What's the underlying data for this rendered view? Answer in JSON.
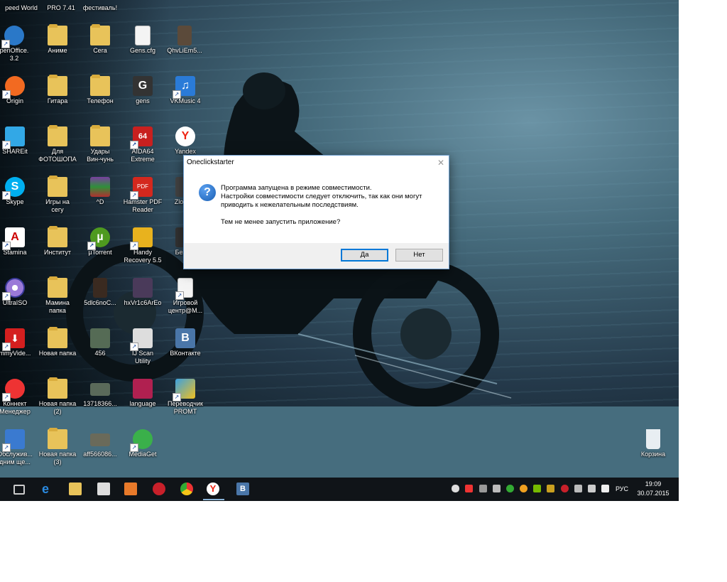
{
  "desktop": {
    "top_labels": [
      "peed World",
      "PRO 7.41",
      "фестиваль!"
    ],
    "icons": [
      {
        "label": "penOffice.\n3.2",
        "icon": "openoffice-icon"
      },
      {
        "label": "Аниме",
        "icon": "folder-icon"
      },
      {
        "label": "Сега",
        "icon": "folder-icon"
      },
      {
        "label": "Gens.cfg",
        "icon": "file-icon"
      },
      {
        "label": "QhvLiEm5...",
        "icon": "image-icon"
      },
      {
        "label": "Origin",
        "icon": "origin-icon"
      },
      {
        "label": "Гитара",
        "icon": "folder-icon"
      },
      {
        "label": "Телефон",
        "icon": "folder-icon"
      },
      {
        "label": "gens",
        "icon": "gens-icon"
      },
      {
        "label": "VKMusic 4",
        "icon": "vkmusic-icon"
      },
      {
        "label": "SHAREit",
        "icon": "shareit-icon"
      },
      {
        "label": "Для\nФОТОШОПА",
        "icon": "folder-icon"
      },
      {
        "label": "Удары\nВин-чунь",
        "icon": "folder-icon"
      },
      {
        "label": "AIDA64\nExtreme",
        "icon": "aida64-icon"
      },
      {
        "label": "Yandex",
        "icon": "yandex-icon"
      },
      {
        "label": "Skype",
        "icon": "skype-icon"
      },
      {
        "label": "Игры на\nсегу",
        "icon": "folder-icon"
      },
      {
        "label": "^D",
        "icon": "winrar-icon"
      },
      {
        "label": "Hamster PDF\nReader",
        "icon": "pdf-icon"
      },
      {
        "label": "ZloBF...",
        "icon": "app-icon"
      },
      {
        "label": "Stamina",
        "icon": "stamina-icon"
      },
      {
        "label": "Институт",
        "icon": "folder-icon"
      },
      {
        "label": "µTorrent",
        "icon": "utorrent-icon"
      },
      {
        "label": "Handy\nRecovery 5.5",
        "icon": "handy-recovery-icon"
      },
      {
        "label": "Безы...",
        "icon": "app-icon"
      },
      {
        "label": "UltraISO",
        "icon": "ultraiso-icon"
      },
      {
        "label": "Мамина\nпапка",
        "icon": "folder-icon"
      },
      {
        "label": "5dlc6noC...",
        "icon": "image-icon"
      },
      {
        "label": "hxVr1c6ArEo",
        "icon": "image-icon"
      },
      {
        "label": "Игровой\nцентр@M...",
        "icon": "game-center-icon"
      },
      {
        "label": "mmyVide...",
        "icon": "video-icon"
      },
      {
        "label": "Новая папка",
        "icon": "folder-icon"
      },
      {
        "label": "456",
        "icon": "image-icon"
      },
      {
        "label": "IJ Scan\nUtility",
        "icon": "scanner-icon"
      },
      {
        "label": "ВКонтакте",
        "icon": "vk-icon"
      },
      {
        "label": "Коннект\nМенеджер",
        "icon": "connect-icon"
      },
      {
        "label": "Новая папка\n(2)",
        "icon": "folder-icon"
      },
      {
        "label": "13718366...",
        "icon": "image-icon"
      },
      {
        "label": "language",
        "icon": "language-icon"
      },
      {
        "label": "Переводчик\nPROMT",
        "icon": "promt-icon"
      },
      {
        "label": "Обслужив...\nдним ще...",
        "icon": "service-icon"
      },
      {
        "label": "Новая папка\n(3)",
        "icon": "folder-icon"
      },
      {
        "label": "aff566086...",
        "icon": "image-icon"
      },
      {
        "label": "MediaGet",
        "icon": "mediaget-icon"
      }
    ],
    "recycle_bin": {
      "label": "Корзина",
      "icon": "recycle-bin-icon"
    }
  },
  "dialog": {
    "title": "Oneclickstarter",
    "icon": "question-icon",
    "line1": "Программа запущена в режиме совместимости.",
    "line2": "Настройки совместимости следует отключить, так как они могут",
    "line3": "приводить к нежелательным последствиям.",
    "line4": "Тем не менее запустить приложение?",
    "yes_label": "Да",
    "no_label": "Нет"
  },
  "taskbar": {
    "apps": [
      "task-view-icon",
      "edge-icon",
      "explorer-icon",
      "store-icon",
      "media-player-icon",
      "opera-icon",
      "chrome-icon",
      "yandex-browser-icon",
      "vk-icon"
    ],
    "tray": [
      "onedrive-icon",
      "volume-alert-icon",
      "bluetooth-icon",
      "network-icon",
      "utorrent-tray-icon",
      "app-tray-icon",
      "nvidia-icon",
      "app-tray-icon",
      "opera-tray-icon",
      "signal-icon",
      "speaker-icon",
      "message-icon"
    ],
    "language": "РУС",
    "time": "19:09",
    "date": "30.07.2015"
  }
}
